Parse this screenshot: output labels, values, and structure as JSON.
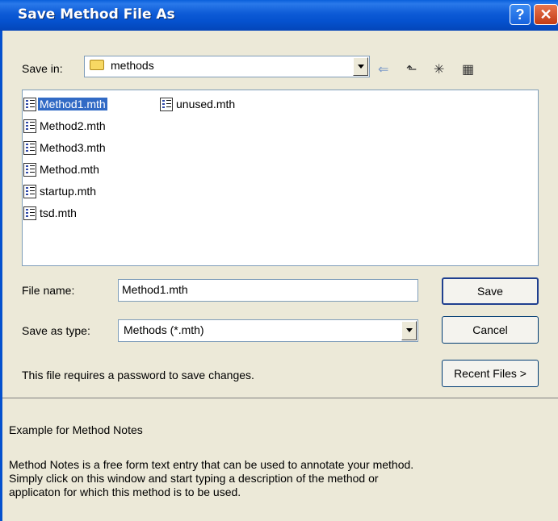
{
  "window": {
    "title": "Save Method File As",
    "help_glyph": "?",
    "close_glyph": "✕"
  },
  "save_in": {
    "label": "Save in:",
    "value": "methods"
  },
  "toolbar": {
    "back_glyph": "⇐",
    "up_glyph": "⬑",
    "new_folder_glyph": "✳",
    "views_glyph": "▦"
  },
  "files": [
    {
      "name": "Method1.mth",
      "selected": true
    },
    {
      "name": "Method2.mth"
    },
    {
      "name": "Method3.mth"
    },
    {
      "name": "Method.mth"
    },
    {
      "name": "startup.mth"
    },
    {
      "name": "tsd.mth"
    },
    {
      "name": "unused.mth"
    }
  ],
  "file_name": {
    "label": "File name:",
    "value": "Method1.mth"
  },
  "save_as_type": {
    "label": "Save as type:",
    "value": "Methods (*.mth)"
  },
  "buttons": {
    "save": "Save",
    "cancel": "Cancel",
    "recent": "Recent Files >"
  },
  "password_note": "This file requires a password to save changes.",
  "notes": {
    "heading": "Example for Method Notes",
    "line1": "Method Notes is a free form text entry that can be used to annotate your method.",
    "line2": "Simply click on this window and start typing a description of the method or",
    "line3": "applicaton for which this method is to be used."
  },
  "colors": {
    "titlebar": "#0551CE",
    "selection": "#316AC5",
    "dialog_bg": "#ECE9D8"
  }
}
